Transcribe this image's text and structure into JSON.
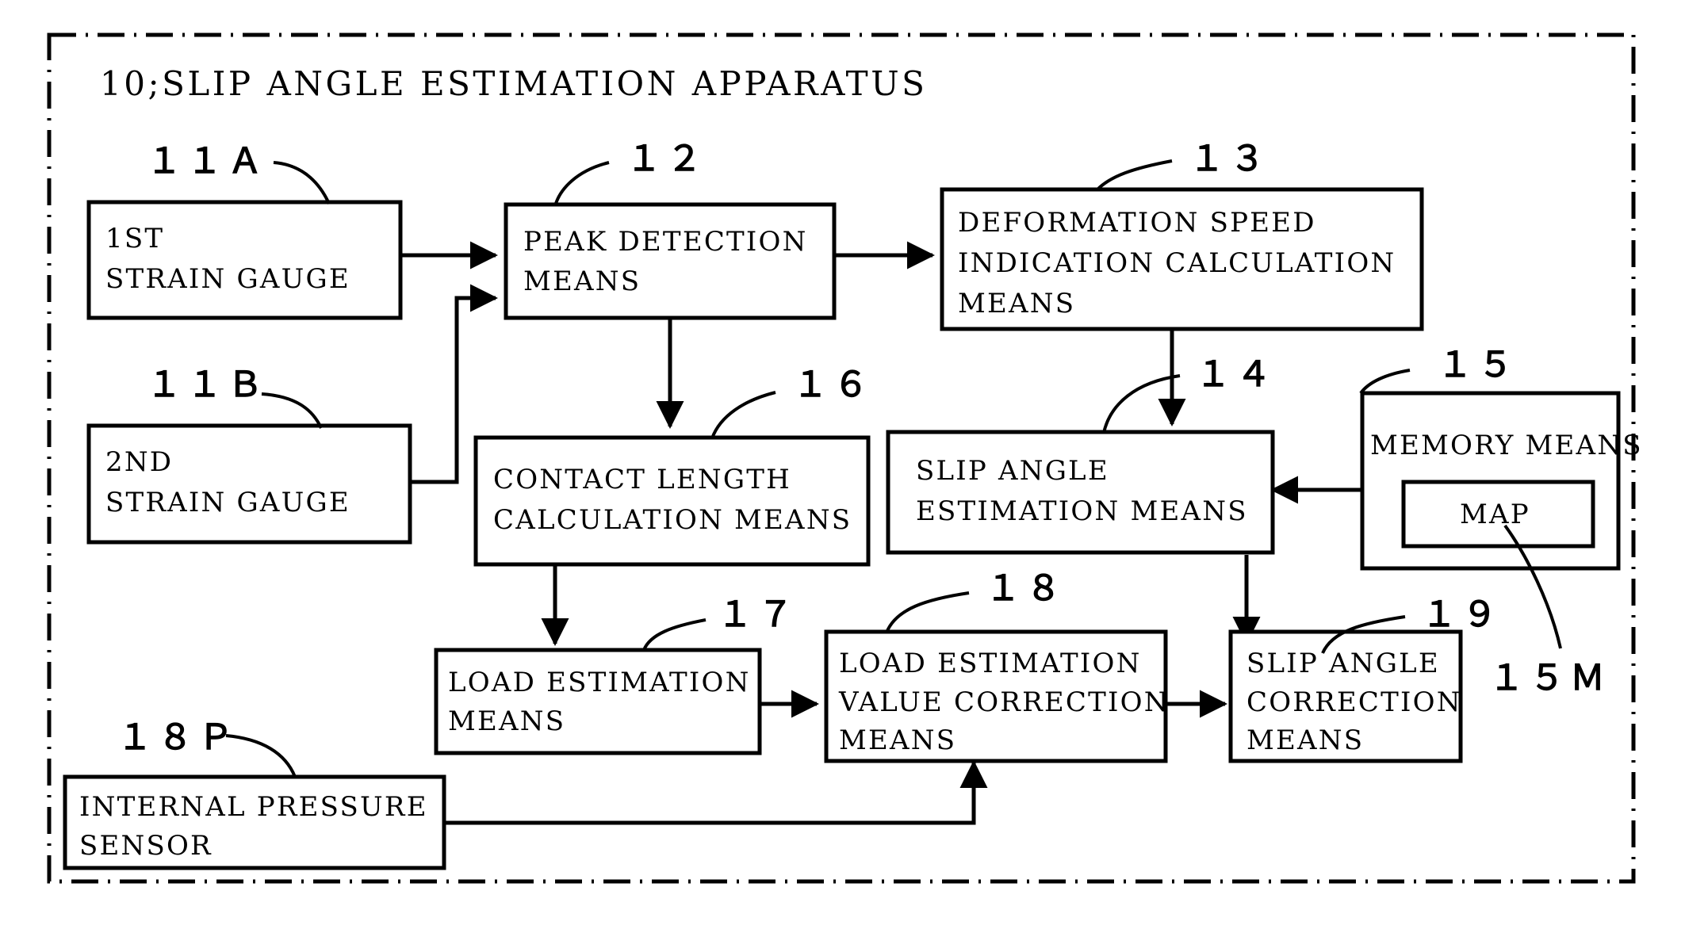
{
  "figure": {
    "title": "10;SLIP ANGLE ESTIMATION APPARATUS",
    "frame_style": "dash-dot",
    "colors": {
      "ink": "#000000",
      "paper": "#ffffff"
    }
  },
  "blocks": [
    {
      "id": "11A",
      "ref": "１１Ａ",
      "lines": [
        "1ST",
        "STRAIN GAUGE"
      ],
      "line1": "1ST",
      "line2": "STRAIN GAUGE",
      "line3": ""
    },
    {
      "id": "11B",
      "ref": "１１Ｂ",
      "lines": [
        "2ND",
        "STRAIN GAUGE"
      ],
      "line1": "2ND",
      "line2": "STRAIN GAUGE",
      "line3": ""
    },
    {
      "id": "12",
      "ref": "１２",
      "lines": [
        "PEAK DETECTION",
        "MEANS"
      ],
      "line1": "PEAK DETECTION",
      "line2": "MEANS",
      "line3": ""
    },
    {
      "id": "13",
      "ref": "１３",
      "lines": [
        "DEFORMATION SPEED",
        "INDICATION CALCULATION",
        "MEANS"
      ],
      "line1": "DEFORMATION SPEED",
      "line2": "INDICATION CALCULATION",
      "line3": "MEANS"
    },
    {
      "id": "14",
      "ref": "１４",
      "lines": [
        "SLIP ANGLE",
        "ESTIMATION MEANS"
      ],
      "line1": "SLIP ANGLE",
      "line2": "ESTIMATION MEANS",
      "line3": ""
    },
    {
      "id": "15",
      "ref": "１５",
      "lines": [
        "MEMORY MEANS"
      ],
      "line1": "MEMORY MEANS",
      "line2": "",
      "line3": ""
    },
    {
      "id": "15M",
      "ref": "１５Ｍ",
      "lines": [
        "MAP"
      ],
      "line1": "MAP",
      "line2": "",
      "line3": ""
    },
    {
      "id": "16",
      "ref": "１６",
      "lines": [
        "CONTACT LENGTH",
        "CALCULATION MEANS"
      ],
      "line1": "CONTACT LENGTH",
      "line2": "CALCULATION MEANS",
      "line3": ""
    },
    {
      "id": "17",
      "ref": "１７",
      "lines": [
        "LOAD ESTIMATION",
        "MEANS"
      ],
      "line1": "LOAD ESTIMATION",
      "line2": "MEANS",
      "line3": ""
    },
    {
      "id": "18",
      "ref": "１８",
      "lines": [
        "LOAD ESTIMATION",
        "VALUE CORRECTION",
        "MEANS"
      ],
      "line1": "LOAD ESTIMATION",
      "line2": "VALUE CORRECTION",
      "line3": "MEANS"
    },
    {
      "id": "18P",
      "ref": "１８Ｐ",
      "lines": [
        "INTERNAL PRESSURE",
        "SENSOR"
      ],
      "line1": "INTERNAL PRESSURE",
      "line2": "SENSOR",
      "line3": ""
    },
    {
      "id": "19",
      "ref": "１９",
      "lines": [
        "SLIP ANGLE",
        "CORRECTION",
        "MEANS"
      ],
      "line1": "SLIP ANGLE",
      "line2": "CORRECTION",
      "line3": "MEANS"
    }
  ],
  "connections": [
    {
      "from": "11A",
      "to": "12",
      "kind": "arrow"
    },
    {
      "from": "11B",
      "to": "12",
      "kind": "arrow"
    },
    {
      "from": "12",
      "to": "13",
      "kind": "arrow"
    },
    {
      "from": "12",
      "to": "16",
      "kind": "arrow"
    },
    {
      "from": "13",
      "to": "14",
      "kind": "arrow"
    },
    {
      "from": "15",
      "to": "14",
      "kind": "arrow"
    },
    {
      "from": "16",
      "to": "17",
      "kind": "arrow"
    },
    {
      "from": "17",
      "to": "18",
      "kind": "arrow"
    },
    {
      "from": "18P",
      "to": "18",
      "kind": "arrow"
    },
    {
      "from": "18",
      "to": "19",
      "kind": "arrow"
    },
    {
      "from": "14",
      "to": "19",
      "kind": "arrow"
    }
  ]
}
